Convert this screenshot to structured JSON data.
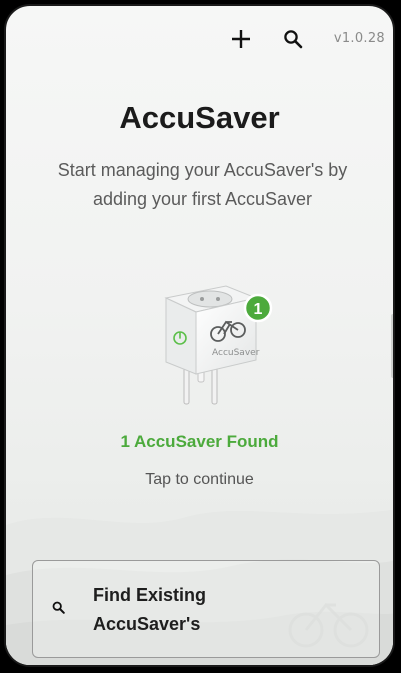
{
  "app": {
    "version": "v1.0.28"
  },
  "topbar": {
    "add_icon": "plus-icon",
    "search_icon": "search-icon"
  },
  "main": {
    "title": "AccuSaver",
    "subtitle": "Start managing your AccuSaver's by adding your first AccuSaver",
    "device": {
      "badge_count": "1",
      "brand_on_plug": "AccuSaver",
      "badge_color": "#4caa3c"
    },
    "found_text": "1 AccuSaver Found",
    "tap_text": "Tap to continue"
  },
  "find_existing": {
    "icon": "search-icon",
    "label": "Find Existing AccuSaver's"
  },
  "colors": {
    "accent_green": "#4caa3c",
    "title_text": "#1b1b1b",
    "muted_text": "#5b5b5b"
  }
}
